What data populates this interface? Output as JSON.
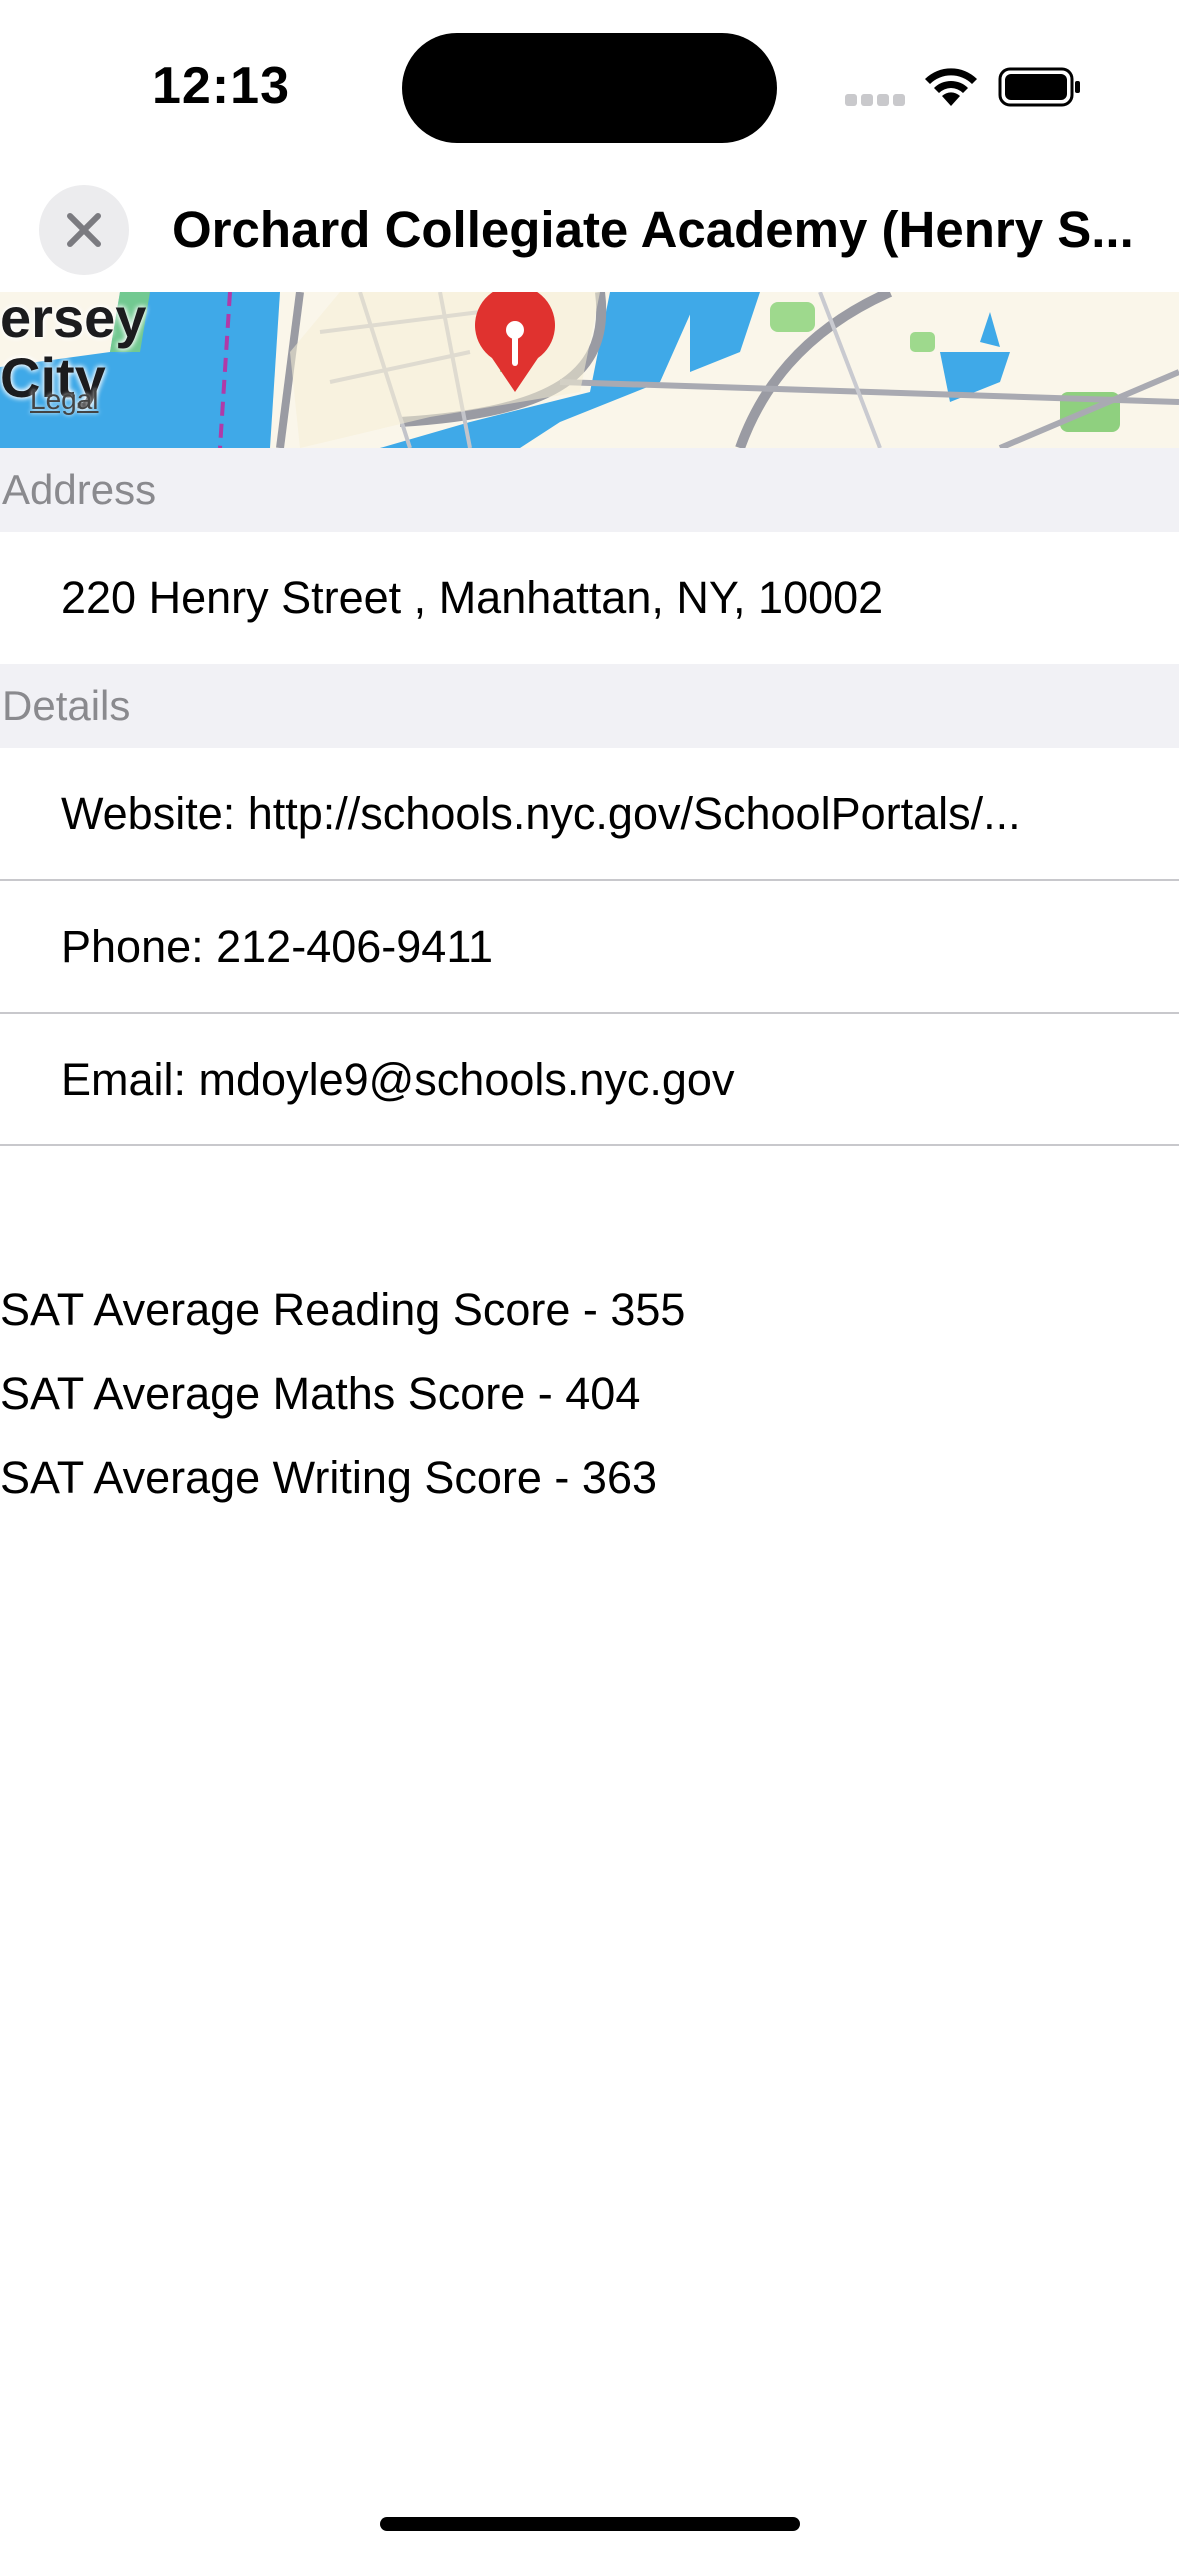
{
  "status_bar": {
    "time": "12:13",
    "icons": [
      "cellular-signal-icon",
      "wifi-icon",
      "battery-icon"
    ]
  },
  "nav": {
    "close_icon": "close-icon",
    "title": "Orchard Collegiate Academy (Henry S..."
  },
  "map": {
    "city_label": "ersey\nCity",
    "legal_label": "Legal",
    "pin_icon": "map-pin-icon"
  },
  "address_section": {
    "header": "Address",
    "address": "220 Henry Street , Manhattan, NY, 10002"
  },
  "details_section": {
    "header": "Details",
    "website": "Website: http://schools.nyc.gov/SchoolPortals/...",
    "phone": "Phone: 212-406-9411",
    "email": "Email: mdoyle9@schools.nyc.gov"
  },
  "sat_scores": {
    "reading": "SAT Average Reading Score - 355",
    "maths": "SAT Average Maths Score - 404",
    "writing": "SAT Average Writing Score - 363"
  },
  "colors": {
    "section_header_bg": "#f1f1f5",
    "section_header_text": "#8a8a8e",
    "divider": "#c8c8cc",
    "pin_red": "#e0322f",
    "water_blue": "#3fa9e8"
  }
}
